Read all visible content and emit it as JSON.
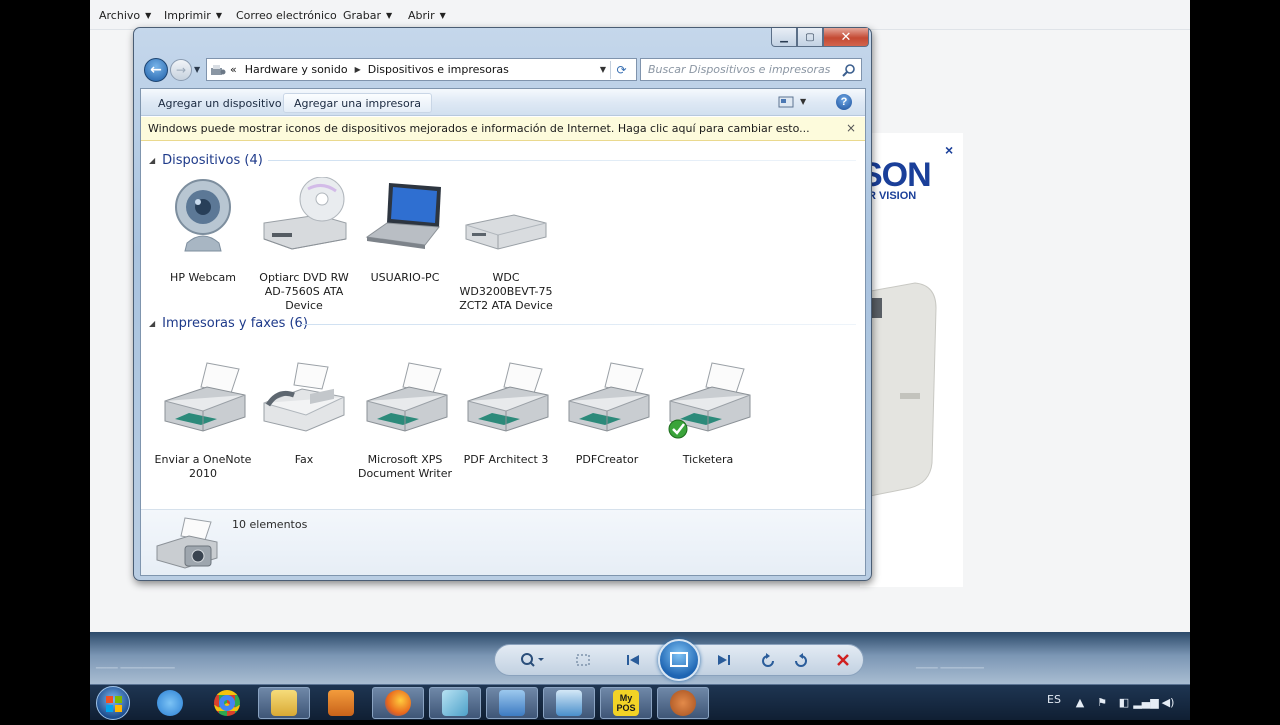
{
  "viewer": {
    "menus": [
      {
        "label": "Archivo"
      },
      {
        "label": "Imprimir"
      },
      {
        "label": "Correo electrónico"
      },
      {
        "label": "Grabar"
      },
      {
        "label": "Abrir"
      }
    ],
    "ad": {
      "logo": "SON",
      "tagline": "UR VISION",
      "close": "×"
    }
  },
  "window": {
    "breadcrumb": {
      "overflow": "«",
      "items": [
        "Hardware y sonido",
        "Dispositivos e impresoras"
      ]
    },
    "search_placeholder": "Buscar Dispositivos e impresoras",
    "commands": {
      "add_device": "Agregar un dispositivo",
      "add_printer": "Agregar una impresora",
      "help": "?"
    },
    "infobar": {
      "text": "Windows puede mostrar iconos de dispositivos mejorados e información de Internet. Haga clic aquí para cambiar esto...",
      "close": "×"
    },
    "groups": [
      {
        "title": "Dispositivos (4)",
        "items": [
          {
            "label": "HP Webcam",
            "icon": "webcam-icon"
          },
          {
            "label": "Optiarc DVD RW AD-7560S ATA Device",
            "icon": "dvd-drive-icon"
          },
          {
            "label": "USUARIO-PC",
            "icon": "laptop-icon"
          },
          {
            "label": "WDC WD3200BEVT-75 ZCT2 ATA Device",
            "icon": "hard-drive-icon"
          }
        ]
      },
      {
        "title": "Impresoras y faxes (6)",
        "items": [
          {
            "label": "Enviar a OneNote 2010",
            "icon": "printer-icon"
          },
          {
            "label": "Fax",
            "icon": "fax-icon"
          },
          {
            "label": "Microsoft XPS Document Writer",
            "icon": "printer-icon"
          },
          {
            "label": "PDF Architect 3",
            "icon": "printer-icon"
          },
          {
            "label": "PDFCreator",
            "icon": "printer-icon"
          },
          {
            "label": "Ticketera",
            "icon": "printer-default-icon",
            "default": true
          }
        ]
      }
    ],
    "details": {
      "count": "10 elementos"
    }
  },
  "taskbar": {
    "apps": [
      {
        "name": "internet-explorer-icon",
        "color": "#2a7fd4"
      },
      {
        "name": "chrome-icon",
        "color": "#d9412d"
      },
      {
        "name": "file-explorer-icon",
        "color": "#e7c14a"
      },
      {
        "name": "media-player-icon",
        "color": "#e67e22"
      },
      {
        "name": "firefox-icon",
        "color": "#e8661c"
      },
      {
        "name": "app-icon",
        "color": "#69b7d8"
      },
      {
        "name": "control-panel-icon",
        "color": "#4a8bd0"
      },
      {
        "name": "photo-viewer-icon",
        "color": "#5ea2d9"
      },
      {
        "name": "mypos-icon",
        "color": "#f2d326",
        "text": "My POS"
      },
      {
        "name": "baseball-glove-icon",
        "color": "#c96a2c"
      }
    ],
    "lang": "ES"
  }
}
